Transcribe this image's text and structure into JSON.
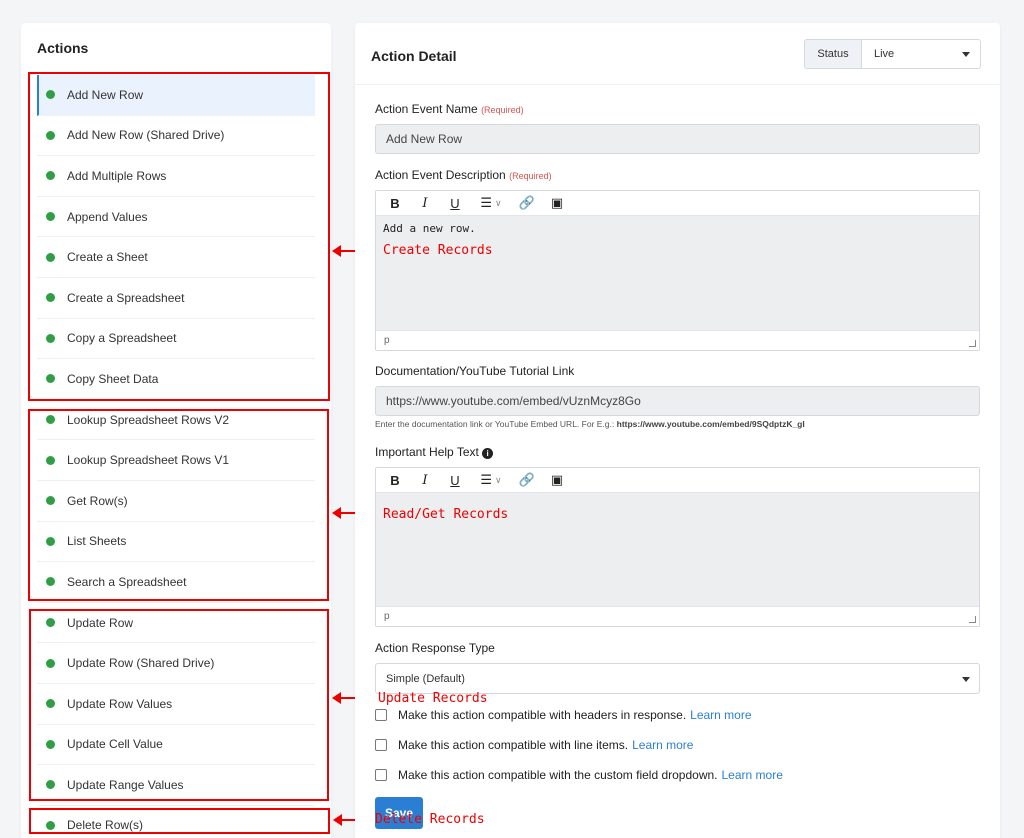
{
  "left": {
    "title": "Actions",
    "items": [
      {
        "label": "Add New Row"
      },
      {
        "label": "Add New Row (Shared Drive)"
      },
      {
        "label": "Add Multiple Rows"
      },
      {
        "label": "Append Values"
      },
      {
        "label": "Create a Sheet"
      },
      {
        "label": "Create a Spreadsheet"
      },
      {
        "label": "Copy a Spreadsheet"
      },
      {
        "label": "Copy Sheet Data"
      },
      {
        "label": "Lookup Spreadsheet Rows V2"
      },
      {
        "label": "Lookup Spreadsheet Rows V1"
      },
      {
        "label": "Get Row(s)"
      },
      {
        "label": "List Sheets"
      },
      {
        "label": "Search a Spreadsheet"
      },
      {
        "label": "Update Row"
      },
      {
        "label": "Update Row (Shared Drive)"
      },
      {
        "label": "Update Row Values"
      },
      {
        "label": "Update Cell Value"
      },
      {
        "label": "Update Range Values"
      },
      {
        "label": "Delete Row(s)"
      }
    ]
  },
  "annotations": {
    "create": "Create Records",
    "read": "Read/Get Records",
    "update": "Update Records",
    "delete": "Delete Records"
  },
  "detail": {
    "title": "Action Detail",
    "status_label": "Status",
    "status_value": "Live",
    "event_name_label": "Action Event Name",
    "required": "(Required)",
    "event_name_value": "Add New Row",
    "description_label": "Action Event Description",
    "description_text": "Add a new row.",
    "editor_footer": "p",
    "doc_label": "Documentation/YouTube Tutorial Link",
    "doc_value": "https://www.youtube.com/embed/vUznMcyz8Go",
    "doc_hint": "Enter the documentation link or YouTube Embed URL. For E.g.:",
    "doc_hint_example": "https://www.youtube.com/embed/9SQdptzK_gI",
    "help_label": "Important Help Text",
    "response_label": "Action Response Type",
    "response_value": "Simple (Default)",
    "checks": [
      {
        "text": "Make this action compatible with headers in response.",
        "link": "Learn more"
      },
      {
        "text": "Make this action compatible with line items.",
        "link": "Learn more"
      },
      {
        "text": "Make this action compatible with the custom field dropdown.",
        "link": "Learn more"
      }
    ],
    "save_label": "Save"
  }
}
